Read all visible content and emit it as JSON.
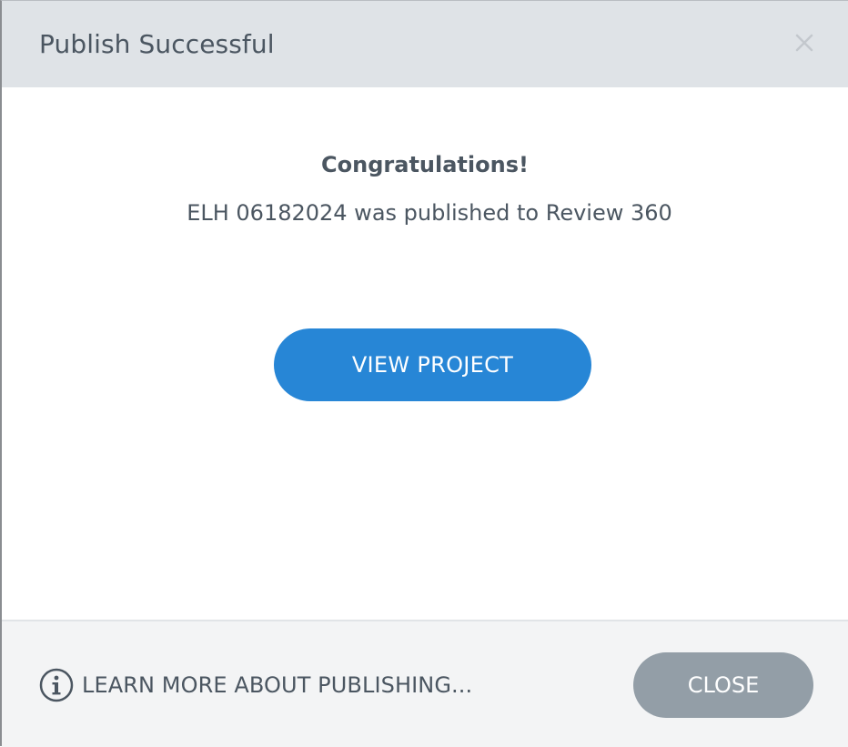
{
  "dialog": {
    "title": "Publish Successful",
    "close_icon": "close-icon"
  },
  "body": {
    "heading": "Congratulations!",
    "message": "ELH 06182024 was published to Review 360",
    "view_project_label": "VIEW PROJECT"
  },
  "footer": {
    "info_icon": "info-icon",
    "learn_more_label": "LEARN MORE ABOUT PUBLISHING...",
    "close_label": "CLOSE"
  },
  "colors": {
    "header_bg": "#dfe3e7",
    "primary_button": "#2786d6",
    "secondary_button": "#939ea7",
    "footer_bg": "#f3f4f5",
    "text": "#4b5661"
  }
}
